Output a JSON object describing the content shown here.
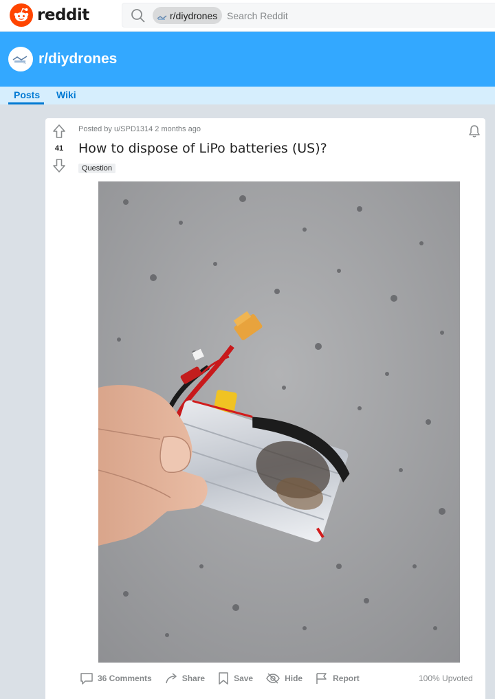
{
  "header": {
    "brand": "reddit",
    "logo_icon": "reddit-alien-icon",
    "search_scope": "r/diydrones",
    "search_placeholder": "Search Reddit"
  },
  "subreddit": {
    "name": "r/diydrones",
    "banner_color": "#33a8ff"
  },
  "nav": {
    "tabs": [
      {
        "label": "Posts",
        "active": true
      },
      {
        "label": "Wiki",
        "active": false
      }
    ]
  },
  "post": {
    "votes": "41",
    "meta": "Posted by u/SPD1314 2 months ago",
    "title": "How to dispose of LiPo batteries (US)?",
    "flair": "Question",
    "image_alt": "Hand holding a damaged, burnt LiPo battery with XT60 connector on a concrete surface",
    "actions": {
      "comments": "36 Comments",
      "share": "Share",
      "save": "Save",
      "hide": "Hide",
      "report": "Report"
    },
    "upvoted": "100% Upvoted"
  },
  "colors": {
    "accent": "#0079d3",
    "reddit_orange": "#ff4500",
    "page_bg": "#dae0e6"
  }
}
